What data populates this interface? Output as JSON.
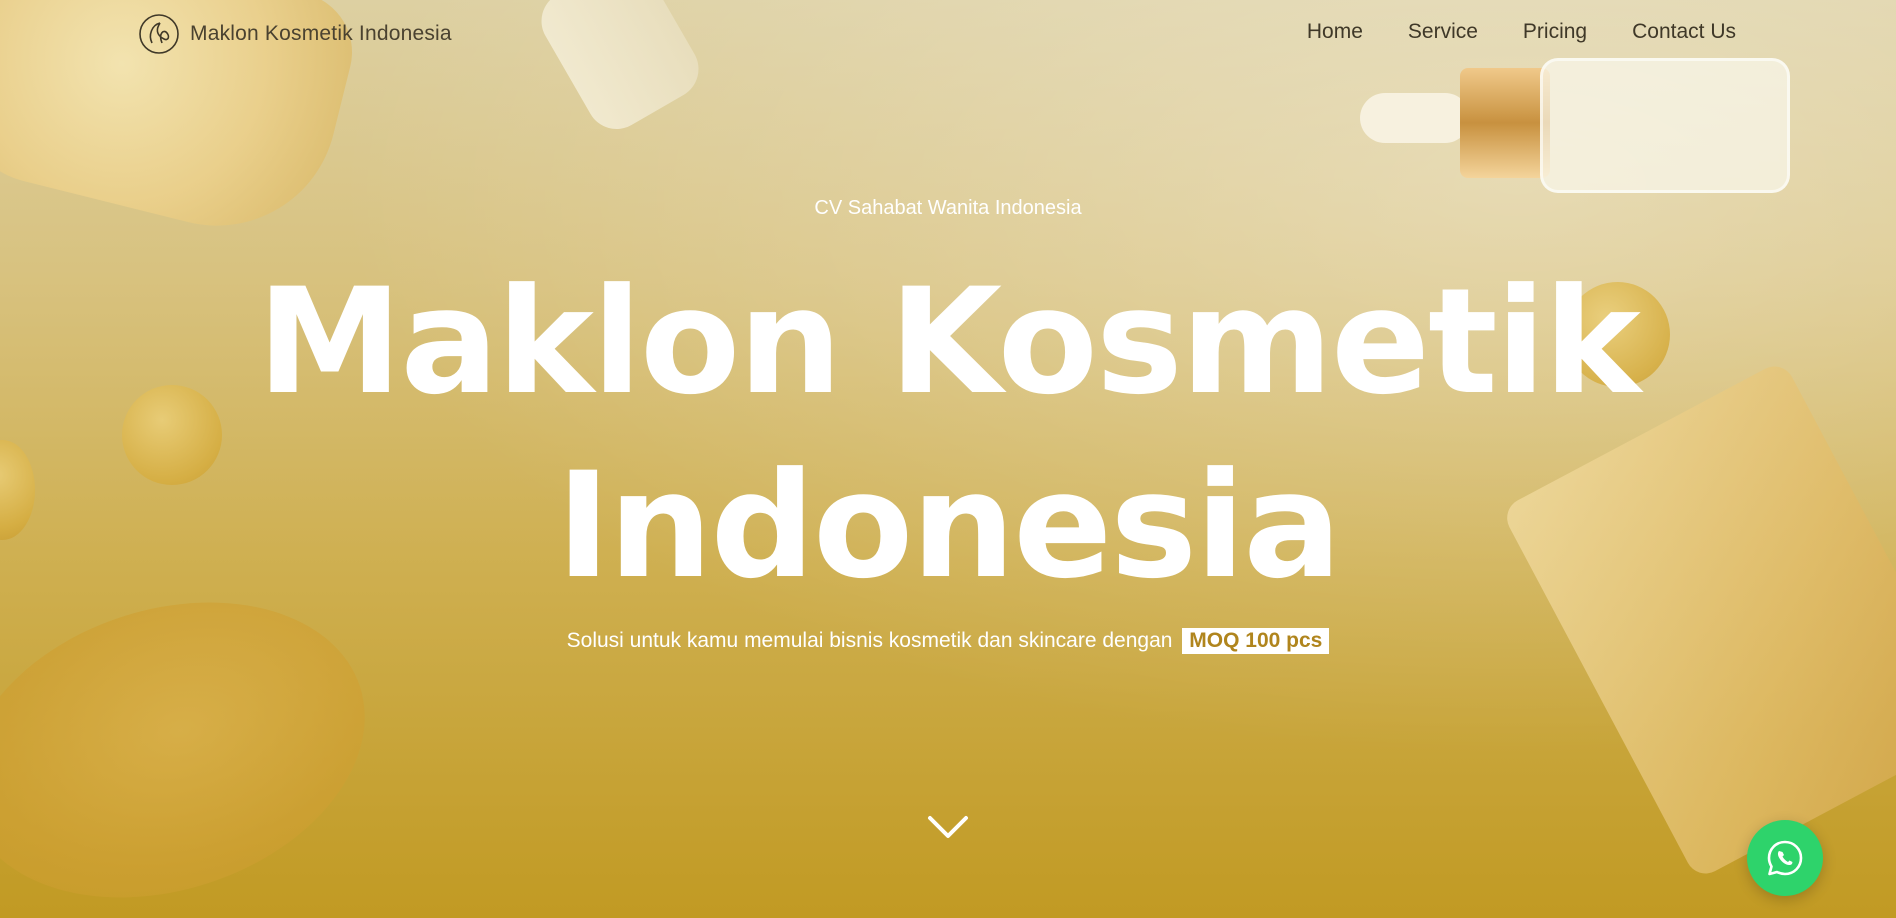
{
  "header": {
    "brand_name": "Maklon Kosmetik Indonesia",
    "logo_icon": "leaf-circle-logo"
  },
  "nav": {
    "items": [
      {
        "label": "Home"
      },
      {
        "label": "Service"
      },
      {
        "label": "Pricing"
      },
      {
        "label": "Contact Us"
      }
    ]
  },
  "hero": {
    "subtitle": "CV Sahabat Wanita Indonesia",
    "title_line1": "Maklon Kosmetik",
    "title_line2": "Indonesia",
    "tagline": "Solusi untuk kamu memulai bisnis kosmetik dan skincare dengan",
    "badge": "MOQ 100 pcs",
    "scroll_icon": "chevron-down-icon"
  },
  "floating": {
    "whatsapp_icon": "whatsapp-icon"
  },
  "colors": {
    "gradient_top": "#ddd0a2",
    "gradient_bottom": "#c19a23",
    "badge_text": "#b0851d",
    "whatsapp_green": "#2ed36b",
    "nav_text": "#3f3828"
  }
}
